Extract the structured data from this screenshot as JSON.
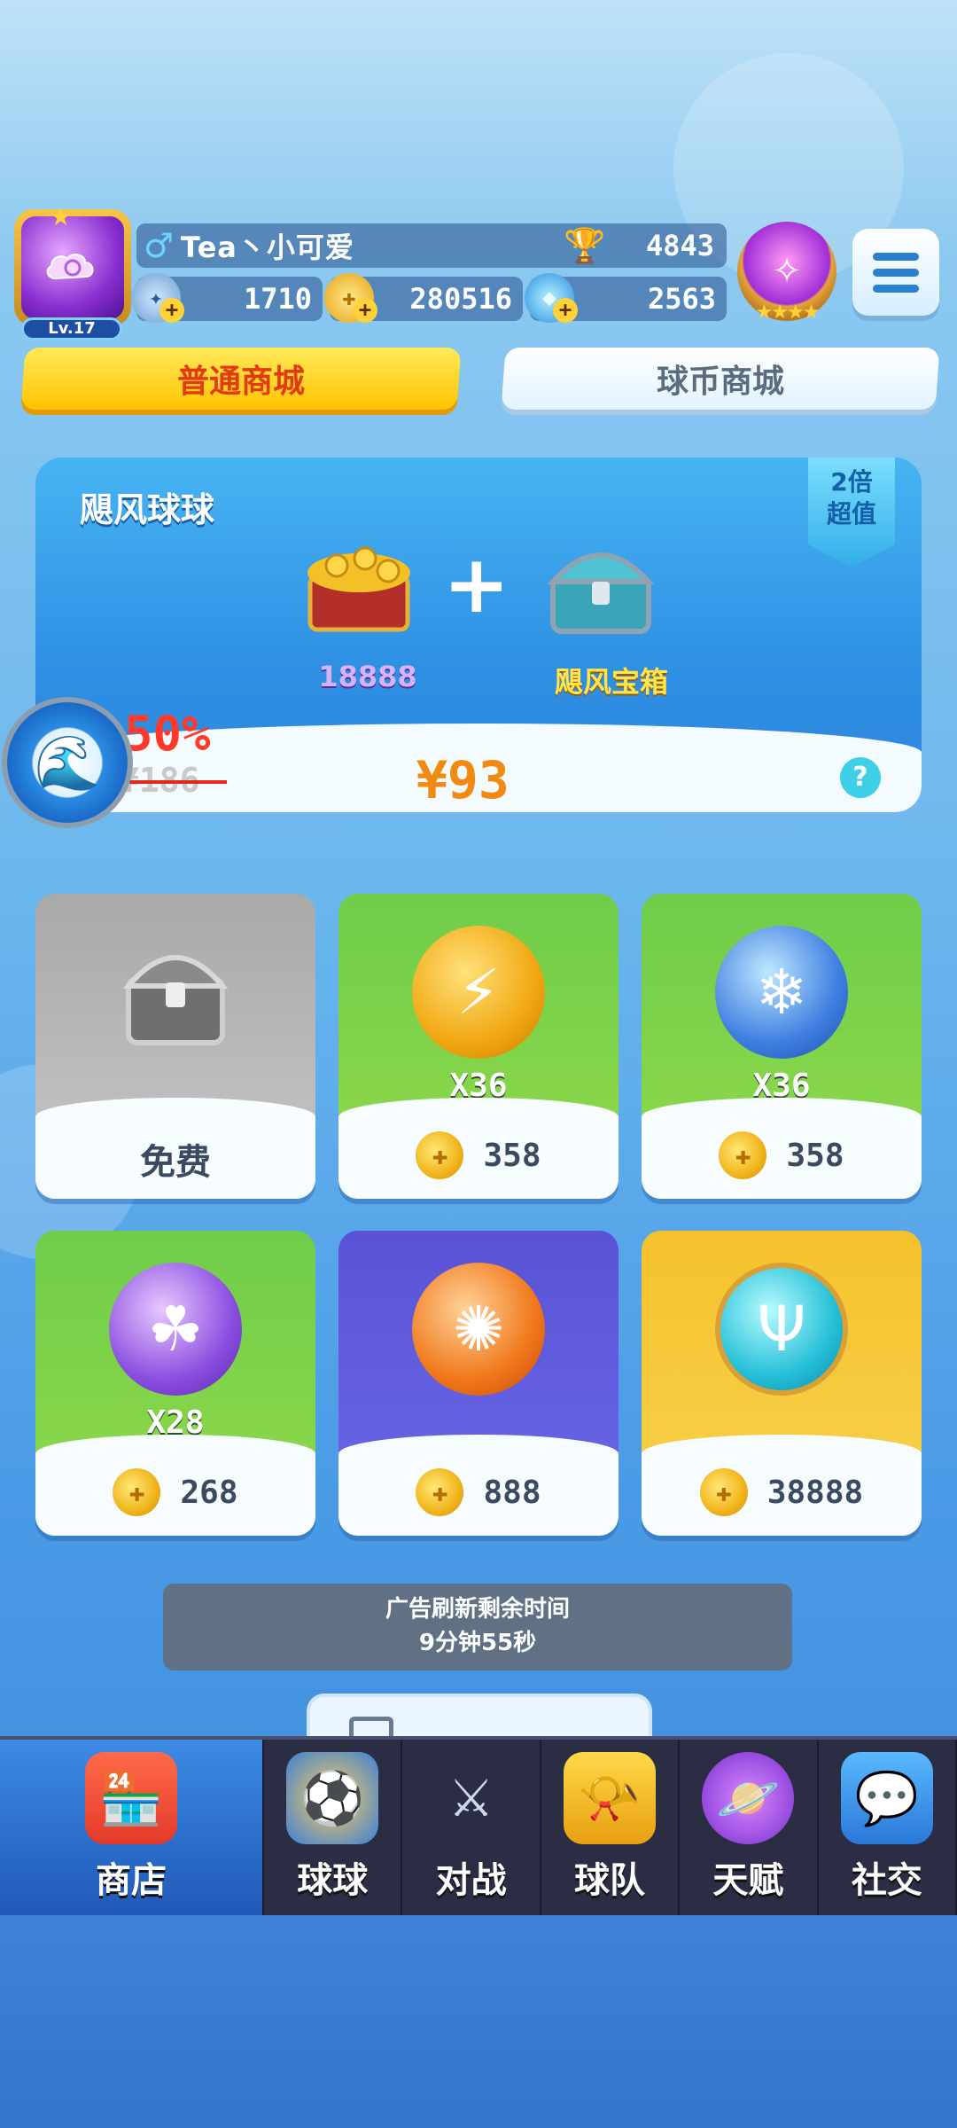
{
  "player": {
    "level": "Lv.17",
    "gender_icon": "♂",
    "name": "Tea丶小可爱",
    "trophies": "4843",
    "energy": "1710",
    "coins": "280516",
    "gems": "2563"
  },
  "tabs": [
    {
      "label": "普通商城",
      "active": true
    },
    {
      "label": "球币商城",
      "active": false
    }
  ],
  "banner": {
    "title": "飓风球球",
    "badge_line1": "2倍",
    "badge_line2": "超值",
    "item1_label": "18888",
    "item2_label": "飓风宝箱",
    "discount": "50%",
    "old_price": "¥186",
    "price": "¥93",
    "help": "?"
  },
  "shop_items": [
    {
      "qty": "",
      "cost": "",
      "free_label": "免费",
      "icon": "chest-icon"
    },
    {
      "qty": "X36",
      "cost": "358",
      "icon": "lightning-ball-icon"
    },
    {
      "qty": "X36",
      "cost": "358",
      "icon": "snowflake-ball-icon"
    },
    {
      "qty": "X28",
      "cost": "268",
      "icon": "clover-ball-icon"
    },
    {
      "qty": "",
      "cost": "888",
      "icon": "sun-ball-icon"
    },
    {
      "qty": "",
      "cost": "38888",
      "icon": "trident-ball-icon"
    }
  ],
  "timer": {
    "line1": "广告刷新剩余时间",
    "line2": "9分钟55秒"
  },
  "nav": [
    {
      "label": "商店",
      "icon": "shop-icon"
    },
    {
      "label": "球球",
      "icon": "balls-icon"
    },
    {
      "label": "对战",
      "icon": "swords-icon"
    },
    {
      "label": "球队",
      "icon": "whistle-icon"
    },
    {
      "label": "天赋",
      "icon": "planet-icon"
    },
    {
      "label": "社交",
      "icon": "chat-icon"
    }
  ],
  "colors": {
    "tab_active": "#ffc400",
    "tab_active_text": "#e23a12",
    "price": "#f28a12",
    "discount": "#ff3a2a"
  }
}
